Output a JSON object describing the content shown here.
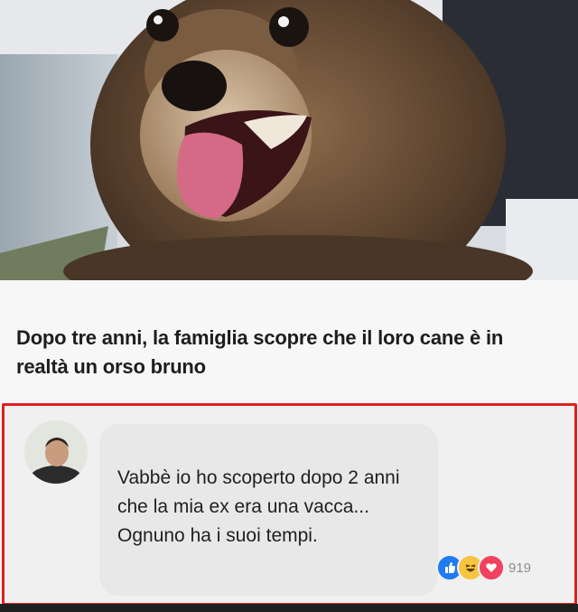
{
  "post": {
    "photo_alt_icon": "bear-cub-photo",
    "headline": "Dopo tre anni, la famiglia scopre che il loro cane è in realtà un orso bruno"
  },
  "comment": {
    "avatar_icon": "user-avatar-icon",
    "text": "Vabbè io ho scoperto dopo 2 anni che la mia ex era una vacca... Ognuno ha i suoi tempi.",
    "reactions": {
      "icons": [
        "like-icon",
        "haha-icon",
        "love-icon"
      ],
      "count": "919"
    }
  },
  "colors": {
    "highlight_border": "#e01f1f",
    "like": "#1f7bf2",
    "haha": "#f6c443",
    "love": "#f0415e"
  }
}
